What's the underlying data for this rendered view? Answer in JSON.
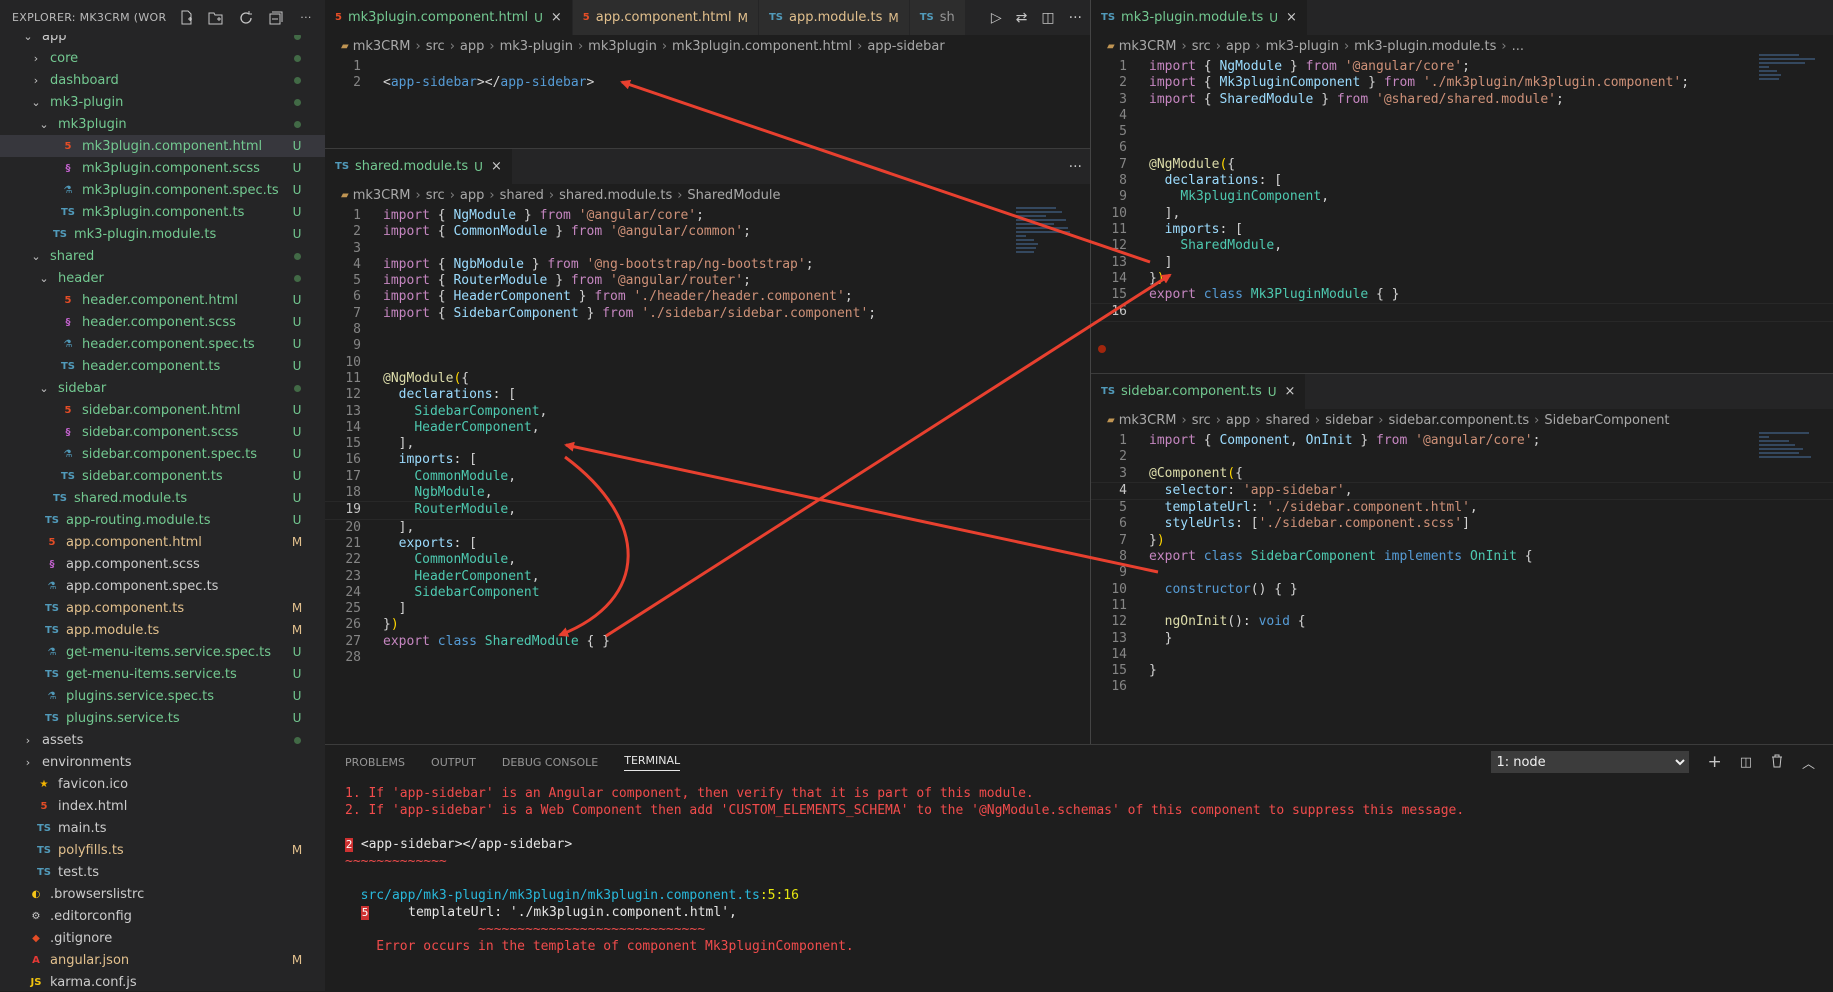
{
  "explorer": {
    "title": "EXPLORER: MK3CRM (WOR...",
    "actions": [
      "new-file-icon",
      "new-folder-icon",
      "refresh-icon",
      "collapse-icon",
      "more-icon"
    ],
    "items": [
      {
        "indent": 1,
        "chev": "v",
        "icon": "folder",
        "label": "app",
        "status": "dot",
        "cls": "c-w"
      },
      {
        "indent": 2,
        "chev": ">",
        "icon": "folder",
        "label": "core",
        "status": "dot",
        "cls": "c-u"
      },
      {
        "indent": 2,
        "chev": ">",
        "icon": "folder",
        "label": "dashboard",
        "status": "dot",
        "cls": "c-u"
      },
      {
        "indent": 2,
        "chev": "v",
        "icon": "folder",
        "label": "mk3-plugin",
        "status": "dot",
        "cls": "c-u"
      },
      {
        "indent": 3,
        "chev": "v",
        "icon": "folder",
        "label": "mk3plugin",
        "status": "dot",
        "cls": "c-u"
      },
      {
        "indent": 4,
        "chev": "",
        "icon": "html",
        "label": "mk3plugin.component.html",
        "status": "U",
        "cls": "c-u",
        "sel": true
      },
      {
        "indent": 4,
        "chev": "",
        "icon": "css",
        "label": "mk3plugin.component.scss",
        "status": "U",
        "cls": "c-u"
      },
      {
        "indent": 4,
        "chev": "",
        "icon": "spec",
        "label": "mk3plugin.component.spec.ts",
        "status": "U",
        "cls": "c-u"
      },
      {
        "indent": 4,
        "chev": "",
        "icon": "ts",
        "label": "mk3plugin.component.ts",
        "status": "U",
        "cls": "c-u"
      },
      {
        "indent": 3,
        "chev": "",
        "icon": "ts",
        "label": "mk3-plugin.module.ts",
        "status": "U",
        "cls": "c-u"
      },
      {
        "indent": 2,
        "chev": "v",
        "icon": "folder",
        "label": "shared",
        "status": "dot",
        "cls": "c-u"
      },
      {
        "indent": 3,
        "chev": "v",
        "icon": "folder",
        "label": "header",
        "status": "dot",
        "cls": "c-u"
      },
      {
        "indent": 4,
        "chev": "",
        "icon": "html",
        "label": "header.component.html",
        "status": "U",
        "cls": "c-u"
      },
      {
        "indent": 4,
        "chev": "",
        "icon": "css",
        "label": "header.component.scss",
        "status": "U",
        "cls": "c-u"
      },
      {
        "indent": 4,
        "chev": "",
        "icon": "spec",
        "label": "header.component.spec.ts",
        "status": "U",
        "cls": "c-u"
      },
      {
        "indent": 4,
        "chev": "",
        "icon": "ts",
        "label": "header.component.ts",
        "status": "U",
        "cls": "c-u"
      },
      {
        "indent": 3,
        "chev": "v",
        "icon": "folder",
        "label": "sidebar",
        "status": "dot",
        "cls": "c-u"
      },
      {
        "indent": 4,
        "chev": "",
        "icon": "html",
        "label": "sidebar.component.html",
        "status": "U",
        "cls": "c-u"
      },
      {
        "indent": 4,
        "chev": "",
        "icon": "css",
        "label": "sidebar.component.scss",
        "status": "U",
        "cls": "c-u"
      },
      {
        "indent": 4,
        "chev": "",
        "icon": "spec",
        "label": "sidebar.component.spec.ts",
        "status": "U",
        "cls": "c-u"
      },
      {
        "indent": 4,
        "chev": "",
        "icon": "ts",
        "label": "sidebar.component.ts",
        "status": "U",
        "cls": "c-u"
      },
      {
        "indent": 3,
        "chev": "",
        "icon": "ts",
        "label": "shared.module.ts",
        "status": "U",
        "cls": "c-u"
      },
      {
        "indent": 2,
        "chev": "",
        "icon": "ts",
        "label": "app-routing.module.ts",
        "status": "U",
        "cls": "c-u"
      },
      {
        "indent": 2,
        "chev": "",
        "icon": "html",
        "label": "app.component.html",
        "status": "M",
        "cls": "c-m"
      },
      {
        "indent": 2,
        "chev": "",
        "icon": "css",
        "label": "app.component.scss",
        "status": "",
        "cls": "c-w"
      },
      {
        "indent": 2,
        "chev": "",
        "icon": "spec",
        "label": "app.component.spec.ts",
        "status": "",
        "cls": "c-w"
      },
      {
        "indent": 2,
        "chev": "",
        "icon": "ts",
        "label": "app.component.ts",
        "status": "M",
        "cls": "c-m"
      },
      {
        "indent": 2,
        "chev": "",
        "icon": "ts",
        "label": "app.module.ts",
        "status": "M",
        "cls": "c-m"
      },
      {
        "indent": 2,
        "chev": "",
        "icon": "spec",
        "label": "get-menu-items.service.spec.ts",
        "status": "U",
        "cls": "c-u"
      },
      {
        "indent": 2,
        "chev": "",
        "icon": "ts",
        "label": "get-menu-items.service.ts",
        "status": "U",
        "cls": "c-u"
      },
      {
        "indent": 2,
        "chev": "",
        "icon": "spec",
        "label": "plugins.service.spec.ts",
        "status": "U",
        "cls": "c-u"
      },
      {
        "indent": 2,
        "chev": "",
        "icon": "ts",
        "label": "plugins.service.ts",
        "status": "U",
        "cls": "c-u"
      },
      {
        "indent": 1,
        "chev": ">",
        "icon": "folder",
        "label": "assets",
        "status": "dot",
        "cls": "c-w"
      },
      {
        "indent": 1,
        "chev": ">",
        "icon": "folder",
        "label": "environments",
        "status": "",
        "cls": "c-w"
      },
      {
        "indent": 1,
        "chev": "",
        "icon": "fav",
        "label": "favicon.ico",
        "status": "",
        "cls": "c-w"
      },
      {
        "indent": 1,
        "chev": "",
        "icon": "html",
        "label": "index.html",
        "status": "",
        "cls": "c-w"
      },
      {
        "indent": 1,
        "chev": "",
        "icon": "ts",
        "label": "main.ts",
        "status": "",
        "cls": "c-w"
      },
      {
        "indent": 1,
        "chev": "",
        "icon": "ts",
        "label": "polyfills.ts",
        "status": "M",
        "cls": "c-m"
      },
      {
        "indent": 1,
        "chev": "",
        "icon": "ts",
        "label": "test.ts",
        "status": "",
        "cls": "c-w"
      },
      {
        "indent": 0,
        "chev": "",
        "icon": "br",
        "label": ".browserslistrc",
        "status": "",
        "cls": "c-w"
      },
      {
        "indent": 0,
        "chev": "",
        "icon": "gear",
        "label": ".editorconfig",
        "status": "",
        "cls": "c-w"
      },
      {
        "indent": 0,
        "chev": "",
        "icon": "git",
        "label": ".gitignore",
        "status": "",
        "cls": "c-w"
      },
      {
        "indent": 0,
        "chev": "",
        "icon": "json",
        "label": "angular.json",
        "status": "M",
        "cls": "c-m"
      },
      {
        "indent": 0,
        "chev": "",
        "icon": "js",
        "label": "karma.conf.js",
        "status": "",
        "cls": "c-w"
      }
    ]
  },
  "group1": {
    "tabs": [
      {
        "icon": "html",
        "label": "mk3plugin.component.html",
        "status": "U",
        "active": true,
        "close": "×"
      },
      {
        "icon": "html",
        "label": "app.component.html",
        "status": "M",
        "active": false,
        "close": ""
      },
      {
        "icon": "TS",
        "label": "app.module.ts",
        "status": "M",
        "active": false,
        "close": ""
      },
      {
        "icon": "TS",
        "label": "sh",
        "status": "",
        "active": false,
        "close": ""
      }
    ],
    "crumbs": [
      "mk3CRM",
      "src",
      "app",
      "mk3-plugin",
      "mk3plugin",
      "mk3plugin.component.html",
      "app-sidebar"
    ],
    "lines": [
      {
        "n": "1",
        "html": ""
      },
      {
        "n": "2",
        "html": "<span class=\"pun\">&lt;</span><span class=\"tag\">app-sidebar</span><span class=\"pun\">&gt;&lt;/</span><span class=\"tag\">app-sidebar</span><span class=\"pun\">&gt;</span>"
      }
    ]
  },
  "group2": {
    "tabs": [
      {
        "icon": "TS",
        "label": "shared.module.ts",
        "status": "U",
        "active": true,
        "close": "×"
      }
    ],
    "crumbs": [
      "mk3CRM",
      "src",
      "app",
      "shared",
      "shared.module.ts",
      "SharedModule"
    ],
    "lines": [
      {
        "n": "1",
        "html": "<span class=\"kw2\">import</span> { <span class=\"id\">NgModule</span> } <span class=\"kw2\">from</span> <span class=\"str\">'@angular/core'</span>;"
      },
      {
        "n": "2",
        "html": "<span class=\"kw2\">import</span> { <span class=\"id\">CommonModule</span> } <span class=\"kw2\">from</span> <span class=\"str\">'@angular/common'</span>;"
      },
      {
        "n": "3",
        "html": ""
      },
      {
        "n": "4",
        "html": "<span class=\"kw2\">import</span> { <span class=\"id\">NgbModule</span> } <span class=\"kw2\">from</span> <span class=\"str\">'@ng-bootstrap/ng-bootstrap'</span>;"
      },
      {
        "n": "5",
        "html": "<span class=\"kw2\">import</span> { <span class=\"id\">RouterModule</span> } <span class=\"kw2\">from</span> <span class=\"str\">'@angular/router'</span>;"
      },
      {
        "n": "6",
        "html": "<span class=\"kw2\">import</span> { <span class=\"id\">HeaderComponent</span> } <span class=\"kw2\">from</span> <span class=\"str\">'./header/header.component'</span>;"
      },
      {
        "n": "7",
        "html": "<span class=\"kw2\">import</span> { <span class=\"id\">SidebarComponent</span> } <span class=\"kw2\">from</span> <span class=\"str\">'./sidebar/sidebar.component'</span>;"
      },
      {
        "n": "8",
        "html": ""
      },
      {
        "n": "9",
        "html": ""
      },
      {
        "n": "10",
        "html": ""
      },
      {
        "n": "11",
        "html": "<span class=\"dec\">@</span><span class=\"fn\">NgModule</span><span class=\"br\">(</span>{"
      },
      {
        "n": "12",
        "html": "  <span class=\"id\">declarations</span>: ["
      },
      {
        "n": "13",
        "html": "    <span class=\"cls\">SidebarComponent</span>,"
      },
      {
        "n": "14",
        "html": "    <span class=\"cls\">HeaderComponent</span>,"
      },
      {
        "n": "15",
        "html": "  ],"
      },
      {
        "n": "16",
        "html": "  <span class=\"id\">imports</span>: ["
      },
      {
        "n": "17",
        "html": "    <span class=\"cls\">CommonModule</span>,"
      },
      {
        "n": "18",
        "html": "    <span class=\"cls\">NgbModule</span>,"
      },
      {
        "n": "19",
        "html": "    <span class=\"cls\">RouterModule</span>,",
        "cur": true
      },
      {
        "n": "20",
        "html": "  ],"
      },
      {
        "n": "21",
        "html": "  <span class=\"id\">exports</span>: ["
      },
      {
        "n": "22",
        "html": "    <span class=\"cls\">CommonModule</span>,"
      },
      {
        "n": "23",
        "html": "    <span class=\"cls\">HeaderComponent</span>,"
      },
      {
        "n": "24",
        "html": "    <span class=\"cls\">SidebarComponent</span>"
      },
      {
        "n": "25",
        "html": "  ]"
      },
      {
        "n": "26",
        "html": "}<span class=\"br\">)</span>"
      },
      {
        "n": "27",
        "html": "<span class=\"kw2\">export</span> <span class=\"kw\">class</span> <span class=\"cls\">SharedModule</span> { }"
      },
      {
        "n": "28",
        "html": ""
      }
    ]
  },
  "group3": {
    "tabs": [
      {
        "icon": "TS",
        "label": "mk3-plugin.module.ts",
        "status": "U",
        "active": true,
        "close": "×"
      }
    ],
    "crumbs": [
      "mk3CRM",
      "src",
      "app",
      "mk3-plugin",
      "mk3-plugin.module.ts",
      "..."
    ],
    "lines": [
      {
        "n": "1",
        "html": "<span class=\"kw2\">import</span> { <span class=\"id\">NgModule</span> } <span class=\"kw2\">from</span> <span class=\"str\">'@angular/core'</span>;"
      },
      {
        "n": "2",
        "html": "<span class=\"kw2\">import</span> { <span class=\"id\">Mk3pluginComponent</span> } <span class=\"kw2\">from</span> <span class=\"str\">'./mk3plugin/mk3plugin.component'</span>;"
      },
      {
        "n": "3",
        "html": "<span class=\"kw2\">import</span> { <span class=\"id\">SharedModule</span> } <span class=\"kw2\">from</span> <span class=\"str\">'@shared/shared.module'</span>;"
      },
      {
        "n": "4",
        "html": ""
      },
      {
        "n": "5",
        "html": ""
      },
      {
        "n": "6",
        "html": ""
      },
      {
        "n": "7",
        "html": "<span class=\"dec\">@</span><span class=\"fn\">NgModule</span><span class=\"br\">(</span>{"
      },
      {
        "n": "8",
        "html": "  <span class=\"id\">declarations</span>: ["
      },
      {
        "n": "9",
        "html": "    <span class=\"cls\">Mk3pluginComponent</span>,"
      },
      {
        "n": "10",
        "html": "  ],"
      },
      {
        "n": "11",
        "html": "  <span class=\"id\">imports</span>: ["
      },
      {
        "n": "12",
        "html": "    <span class=\"cls\">SharedModule</span>,"
      },
      {
        "n": "13",
        "html": "  ]"
      },
      {
        "n": "14",
        "html": "}<span class=\"br\">)</span>"
      },
      {
        "n": "15",
        "html": "<span class=\"kw2\">export</span> <span class=\"kw\">class</span> <span class=\"cls\">Mk3PluginModule</span> { }"
      },
      {
        "n": "16",
        "html": "",
        "cur": true
      }
    ]
  },
  "group4": {
    "tabs": [
      {
        "icon": "TS",
        "label": "sidebar.component.ts",
        "status": "U",
        "active": true,
        "close": "×"
      }
    ],
    "crumbs": [
      "mk3CRM",
      "src",
      "app",
      "shared",
      "sidebar",
      "sidebar.component.ts",
      "SidebarComponent"
    ],
    "lines": [
      {
        "n": "1",
        "html": "<span class=\"kw2\">import</span> { <span class=\"id\">Component</span>, <span class=\"id\">OnInit</span> } <span class=\"kw2\">from</span> <span class=\"str\">'@angular/core'</span>;"
      },
      {
        "n": "2",
        "html": ""
      },
      {
        "n": "3",
        "html": "<span class=\"dec\">@</span><span class=\"fn\">Component</span><span class=\"br\">(</span>{"
      },
      {
        "n": "4",
        "html": "  <span class=\"id\">selector</span>: <span class=\"str\">'app-sidebar'</span>,",
        "cur": true
      },
      {
        "n": "5",
        "html": "  <span class=\"id\">templateUrl</span>: <span class=\"str\">'./sidebar.component.html'</span>,"
      },
      {
        "n": "6",
        "html": "  <span class=\"id\">styleUrls</span>: [<span class=\"str\">'./sidebar.component.scss'</span>]"
      },
      {
        "n": "7",
        "html": "}<span class=\"br\">)</span>"
      },
      {
        "n": "8",
        "html": "<span class=\"kw2\">export</span> <span class=\"kw\">class</span> <span class=\"cls\">SidebarComponent</span> <span class=\"kw\">implements</span> <span class=\"cls\">OnInit</span> {"
      },
      {
        "n": "9",
        "html": ""
      },
      {
        "n": "10",
        "html": "  <span class=\"kw\">constructor</span>() { }"
      },
      {
        "n": "11",
        "html": ""
      },
      {
        "n": "12",
        "html": "  <span class=\"fn\">ngOnInit</span>(): <span class=\"kw\">void</span> {"
      },
      {
        "n": "13",
        "html": "  }"
      },
      {
        "n": "14",
        "html": ""
      },
      {
        "n": "15",
        "html": "}"
      },
      {
        "n": "16",
        "html": ""
      }
    ]
  },
  "panel": {
    "tabs": [
      "PROBLEMS",
      "OUTPUT",
      "DEBUG CONSOLE",
      "TERMINAL"
    ],
    "active_tab": "TERMINAL",
    "terminal_select": "1: node",
    "lines": [
      {
        "cls": "tred",
        "text": "1. If 'app-sidebar' is an Angular component, then verify that it is part of this module."
      },
      {
        "cls": "tred",
        "text": "2. If 'app-sidebar' is a Web Component then add 'CUSTOM_ELEMENTS_SCHEMA' to the '@NgModule.schemas' of this component to suppress this message."
      },
      {
        "cls": "",
        "text": ""
      },
      {
        "cls": "twhite",
        "badge": "2",
        "text": "<app-sidebar></app-sidebar>"
      },
      {
        "cls": "tred",
        "text": "~~~~~~~~~~~~~"
      },
      {
        "cls": "",
        "text": ""
      },
      {
        "cls": "tcyan",
        "text": "  src/app/mk3-plugin/mk3plugin/mk3plugin.component.ts",
        "suffix": ":5:16"
      },
      {
        "cls": "twhite",
        "badge": "5",
        "text": "    templateUrl: './mk3plugin.component.html',",
        "indent": "    "
      },
      {
        "cls": "tred",
        "text": "                 ~~~~~~~~~~~~~~~~~~~~~~~~~~~~~"
      },
      {
        "cls": "tred",
        "text": "    Error occurs in the template of component Mk3pluginComponent."
      }
    ]
  }
}
